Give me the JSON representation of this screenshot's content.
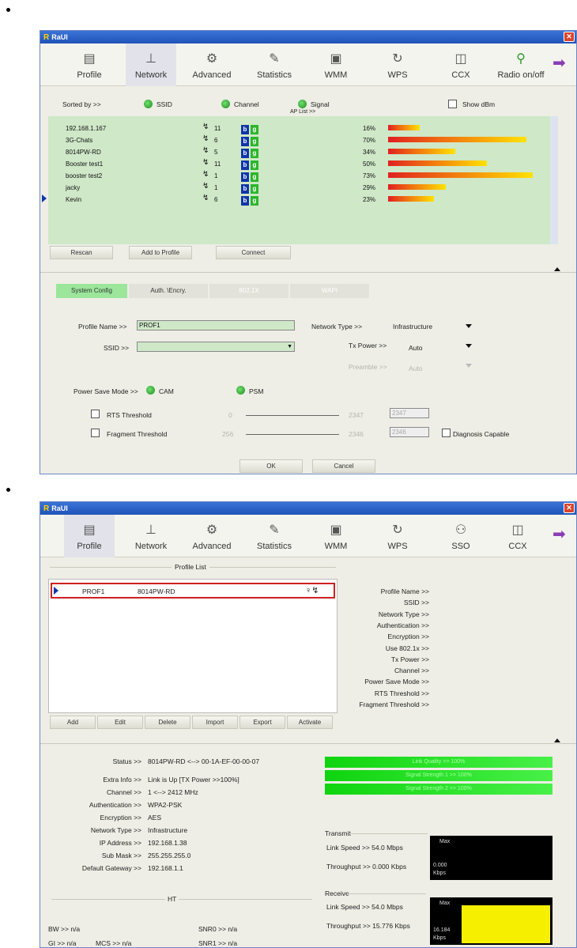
{
  "window_title": "RaUI",
  "close_glyph": "✕",
  "toolbar1": [
    "Profile",
    "Network",
    "Advanced",
    "Statistics",
    "WMM",
    "WPS",
    "CCX",
    "Radio on/off"
  ],
  "toolbar2": [
    "Profile",
    "Network",
    "Advanced",
    "Statistics",
    "WMM",
    "WPS",
    "SSO",
    "CCX"
  ],
  "network": {
    "sorted_by": "Sorted by >>",
    "sort_ssid": "SSID",
    "sort_channel": "Channel",
    "sort_signal": "Signal",
    "ap_list": "AP List >>",
    "show_dbm": "Show dBm",
    "rows": [
      {
        "ssid": "192.168.1.167",
        "channel": "11",
        "signal": "16%",
        "level": 0.16
      },
      {
        "ssid": "3G-Chats",
        "channel": "6",
        "signal": "70%",
        "level": 0.7
      },
      {
        "ssid": "8014PW-RD",
        "channel": "5",
        "signal": "34%",
        "level": 0.34
      },
      {
        "ssid": "Booster test1",
        "channel": "11",
        "signal": "50%",
        "level": 0.5
      },
      {
        "ssid": "booster test2",
        "channel": "1",
        "signal": "73%",
        "level": 0.73
      },
      {
        "ssid": "jacky",
        "channel": "1",
        "signal": "29%",
        "level": 0.29
      },
      {
        "ssid": "Kevin",
        "channel": "6",
        "signal": "23%",
        "level": 0.23
      }
    ],
    "btn_rescan": "Rescan",
    "btn_add": "Add to Profile",
    "btn_connect": "Connect",
    "tab_sys": "System Config",
    "tab_auth": "Auth. \\Encry.",
    "tab_8021x": "802.1X",
    "tab_wapi": "WAPI",
    "profile_name_label": "Profile Name >>",
    "profile_name_value": "PROF1",
    "ssid_label": "SSID >>",
    "network_type_label": "Network Type >>",
    "network_type_value": "Infrastructure",
    "tx_power_label": "Tx Power >>",
    "tx_power_value": "Auto",
    "preamble_label": "Preamble >>",
    "preamble_value": "Auto",
    "power_save_label": "Power Save Mode >>",
    "cam": "CAM",
    "psm": "PSM",
    "rts_label": "RTS Threshold",
    "rts_min": "0",
    "rts_max": "2347",
    "rts_value": "2347",
    "frag_label": "Fragment Threshold",
    "frag_min": "256",
    "frag_max": "2346",
    "frag_value": "2346",
    "diag": "Diagnosis Capable",
    "ok": "OK",
    "cancel": "Cancel"
  },
  "profile": {
    "list_title": "Profile List",
    "profile_name": "PROF1",
    "profile_ssid": "8014PW-RD",
    "btns": [
      "Add",
      "Edit",
      "Delete",
      "Import",
      "Export",
      "Activate"
    ],
    "right_labels": [
      "Profile Name >>",
      "SSID >>",
      "Network Type >>",
      "Authentication >>",
      "Encryption >>",
      "Use 802.1x >>",
      "Tx Power >>",
      "Channel >>",
      "Power Save Mode >>",
      "RTS Threshold >>",
      "Fragment Threshold >>"
    ],
    "status_label": "Status >>",
    "status_value": "8014PW-RD <--> 00-1A-EF-00-00-07",
    "extra_label": "Extra Info >>",
    "extra_value": "Link is Up [TX Power >>100%]",
    "channel_label": "Channel >>",
    "channel_value": "1 <--> 2412 MHz",
    "auth_label": "Authentication >>",
    "auth_value": "WPA2-PSK",
    "enc_label": "Encryption >>",
    "enc_value": "AES",
    "nettype_label": "Network Type >>",
    "nettype_value": "Infrastructure",
    "ip_label": "IP Address >>",
    "ip_value": "192.168.1.38",
    "mask_label": "Sub Mask >>",
    "mask_value": "255.255.255.0",
    "gw_label": "Default Gateway >>",
    "gw_value": "192.168.1.1",
    "ht": "HT",
    "bw": "BW >> n/a",
    "gi": "GI >> n/a",
    "mcs": "MCS >> n/a",
    "snr0": "SNR0 >> n/a",
    "snr1": "SNR1 >> n/a",
    "link_quality": "Link Quality >> 100%",
    "sig1": "Signal Strength 1 >> 100%",
    "sig2": "Signal Strength 2 >> 100%",
    "transmit": "Transmit",
    "tx_link": "Link Speed >> 54.0 Mbps",
    "tx_thr": "Throughput >> 0.000 Kbps",
    "receive": "Receive",
    "rx_link": "Link Speed >> 54.0 Mbps",
    "rx_thr": "Throughput >> 15.776 Kbps",
    "max": "Max",
    "tx_scope_val": "0.000",
    "rx_scope_val": "16.184",
    "kbps": "Kbps"
  }
}
